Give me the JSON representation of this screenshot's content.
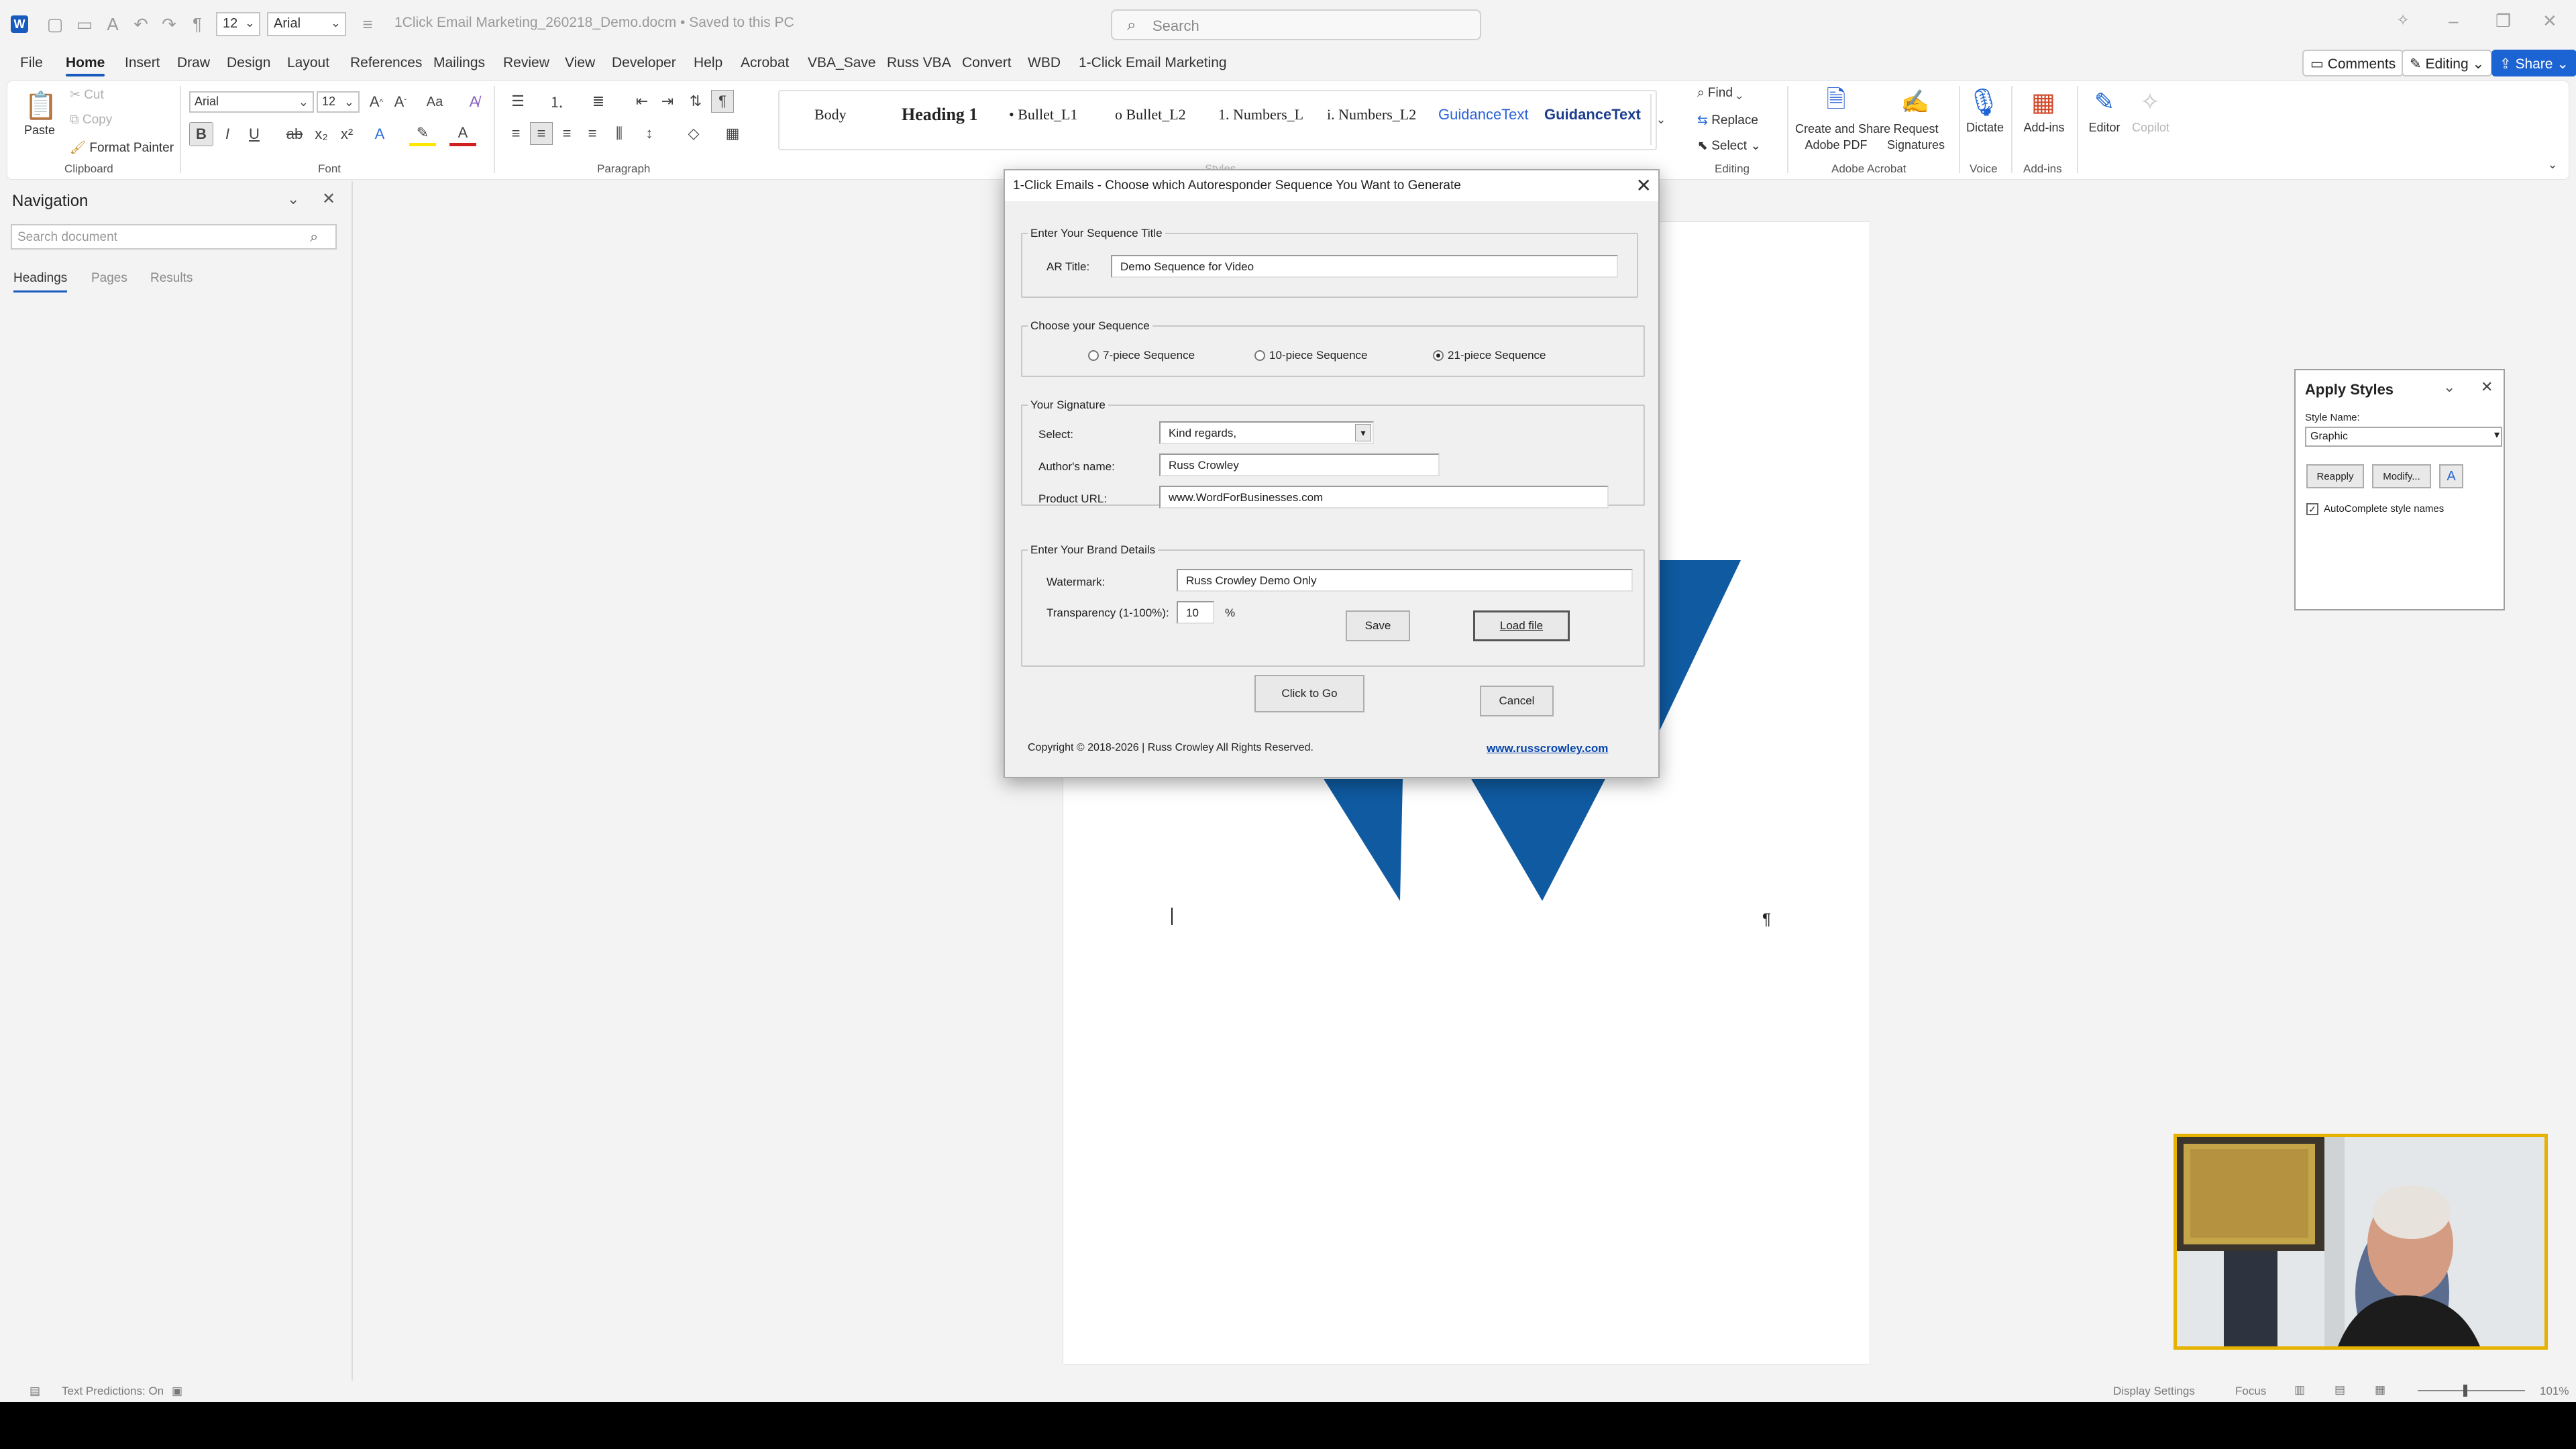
{
  "titlebar": {
    "font_size": "12",
    "font_name": "Arial",
    "doc_title": "1Click Email Marketing_260218_Demo.docm • Saved to this PC",
    "search_placeholder": "Search"
  },
  "menu": {
    "tabs": [
      "File",
      "Home",
      "Insert",
      "Draw",
      "Design",
      "Layout",
      "References",
      "Mailings",
      "Review",
      "View",
      "Developer",
      "Help",
      "Acrobat",
      "VBA_Save",
      "Russ VBA",
      "Convert",
      "WBD",
      "1-Click Email Marketing"
    ],
    "comments": "Comments",
    "editing": "Editing",
    "share": "Share"
  },
  "ribbon": {
    "clipboard": {
      "paste": "Paste",
      "cut": "Cut",
      "copy": "Copy",
      "format_painter": "Format Painter",
      "label": "Clipboard"
    },
    "font": {
      "name": "Arial",
      "size": "12",
      "label": "Font"
    },
    "paragraph": {
      "label": "Paragraph"
    },
    "styles": {
      "items": [
        "Body",
        "Heading 1",
        "• Bullet_L1",
        "o Bullet_L2",
        "1. Numbers_L",
        "i. Numbers_L2",
        "GuidanceText",
        "GuidanceText"
      ],
      "label": "Styles"
    },
    "editing": {
      "find": "Find",
      "replace": "Replace",
      "select": "Select",
      "label": "Editing"
    },
    "acrobat": {
      "create": "Create and Share",
      "create2": "Adobe PDF",
      "request": "Request",
      "request2": "Signatures",
      "label": "Adobe Acrobat"
    },
    "voice": {
      "dictate": "Dictate",
      "label": "Voice"
    },
    "addins": {
      "addins": "Add-ins",
      "label": "Add-ins"
    },
    "editor": "Editor",
    "copilot": "Copilot"
  },
  "navigation": {
    "title": "Navigation",
    "search_placeholder": "Search document",
    "tabs": [
      "Headings",
      "Pages",
      "Results"
    ]
  },
  "dialog": {
    "title": "1-Click Emails - Choose which Autoresponder Sequence You Want to Generate",
    "sequence_title": {
      "legend": "Enter Your Sequence Title",
      "label": "AR Title:",
      "value": "Demo Sequence for Video"
    },
    "sequence": {
      "legend": "Choose your Sequence",
      "options": [
        "7-piece Sequence",
        "10-piece Sequence",
        "21-piece Sequence"
      ],
      "selected": "21-piece Sequence"
    },
    "signature": {
      "legend": "Your Signature",
      "select_label": "Select:",
      "select_value": "Kind regards,",
      "author_label": "Author's name:",
      "author_value": "Russ Crowley",
      "url_label": "Product URL:",
      "url_value": "www.WordForBusinesses.com"
    },
    "brand": {
      "legend": "Enter Your Brand Details",
      "watermark_label": "Watermark:",
      "watermark_value": "Russ Crowley Demo Only",
      "transparency_label": "Transparency (1-100%):",
      "transparency_value": "10",
      "percent": "%",
      "save": "Save",
      "load": "Load file"
    },
    "go": "Click to Go",
    "cancel": "Cancel",
    "copyright": "Copyright © 2018-2026 | Russ Crowley All Rights Reserved.",
    "link": "www.russcrowley.com"
  },
  "apply_styles": {
    "title": "Apply Styles",
    "style_name_label": "Style Name:",
    "style_name_value": "Graphic",
    "reapply": "Reapply",
    "modify": "Modify...",
    "autocomplete": "AutoComplete style names"
  },
  "statusbar": {
    "text_predictions": "Text Predictions: On",
    "display_settings": "Display Settings",
    "focus": "Focus",
    "zoom": "101%"
  },
  "colors": {
    "accent": "#185abd",
    "logo_blue": "#0f5aa0",
    "webcam_border": "#e6b200"
  }
}
